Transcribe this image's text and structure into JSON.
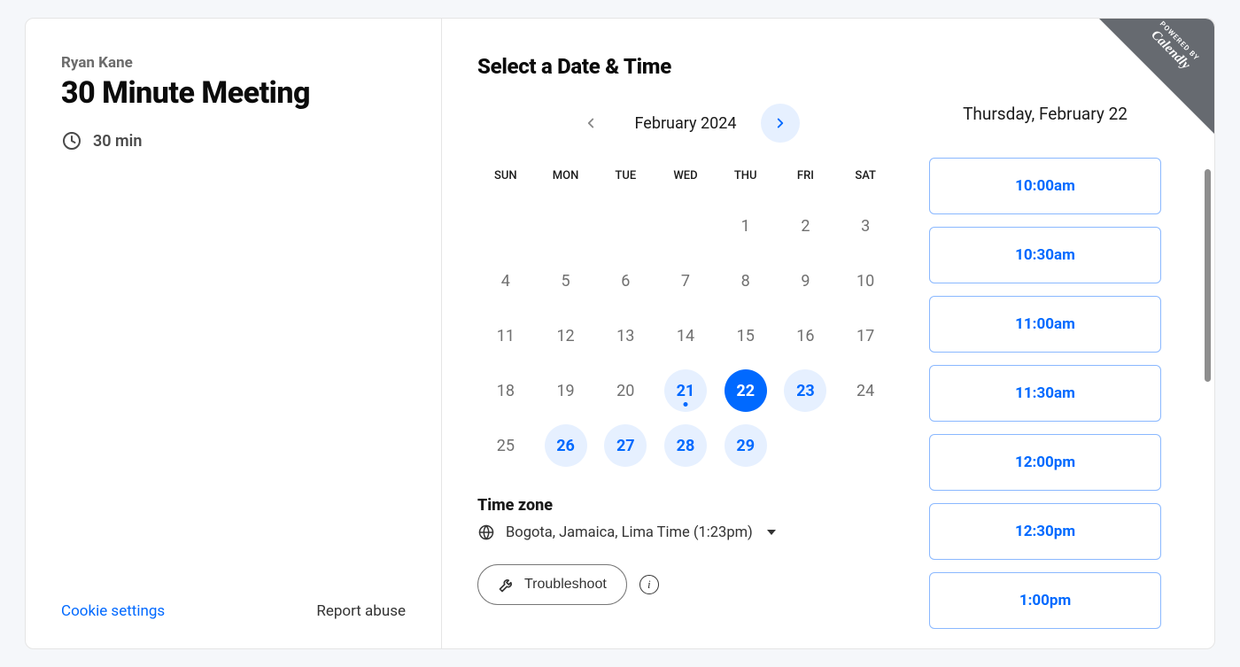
{
  "host_name": "Ryan Kane",
  "event_title": "30 Minute Meeting",
  "duration_label": "30 min",
  "select_heading": "Select a Date & Time",
  "month_label": "February 2024",
  "selected_date_label": "Thursday, February 22",
  "dow": [
    "SUN",
    "MON",
    "TUE",
    "WED",
    "THU",
    "FRI",
    "SAT"
  ],
  "calendar": {
    "weeks": [
      [
        null,
        null,
        null,
        null,
        {
          "d": 1,
          "a": false
        },
        {
          "d": 2,
          "a": false
        },
        {
          "d": 3,
          "a": false
        }
      ],
      [
        {
          "d": 4,
          "a": false
        },
        {
          "d": 5,
          "a": false
        },
        {
          "d": 6,
          "a": false
        },
        {
          "d": 7,
          "a": false
        },
        {
          "d": 8,
          "a": false
        },
        {
          "d": 9,
          "a": false
        },
        {
          "d": 10,
          "a": false
        }
      ],
      [
        {
          "d": 11,
          "a": false
        },
        {
          "d": 12,
          "a": false
        },
        {
          "d": 13,
          "a": false
        },
        {
          "d": 14,
          "a": false
        },
        {
          "d": 15,
          "a": false
        },
        {
          "d": 16,
          "a": false
        },
        {
          "d": 17,
          "a": false
        }
      ],
      [
        {
          "d": 18,
          "a": false
        },
        {
          "d": 19,
          "a": false
        },
        {
          "d": 20,
          "a": false
        },
        {
          "d": 21,
          "a": true,
          "today": true
        },
        {
          "d": 22,
          "a": true,
          "selected": true
        },
        {
          "d": 23,
          "a": true
        },
        {
          "d": 24,
          "a": false
        }
      ],
      [
        {
          "d": 25,
          "a": false
        },
        {
          "d": 26,
          "a": true
        },
        {
          "d": 27,
          "a": true
        },
        {
          "d": 28,
          "a": true
        },
        {
          "d": 29,
          "a": true
        },
        null,
        null
      ]
    ]
  },
  "timezone": {
    "heading": "Time zone",
    "label": "Bogota, Jamaica, Lima Time (1:23pm)"
  },
  "troubleshoot_label": "Troubleshoot",
  "time_slots": [
    "10:00am",
    "10:30am",
    "11:00am",
    "11:30am",
    "12:00pm",
    "12:30pm",
    "1:00pm"
  ],
  "cookie_settings_label": "Cookie settings",
  "report_abuse_label": "Report abuse",
  "badge": {
    "line1": "POWERED BY",
    "line2": "Calendly"
  }
}
